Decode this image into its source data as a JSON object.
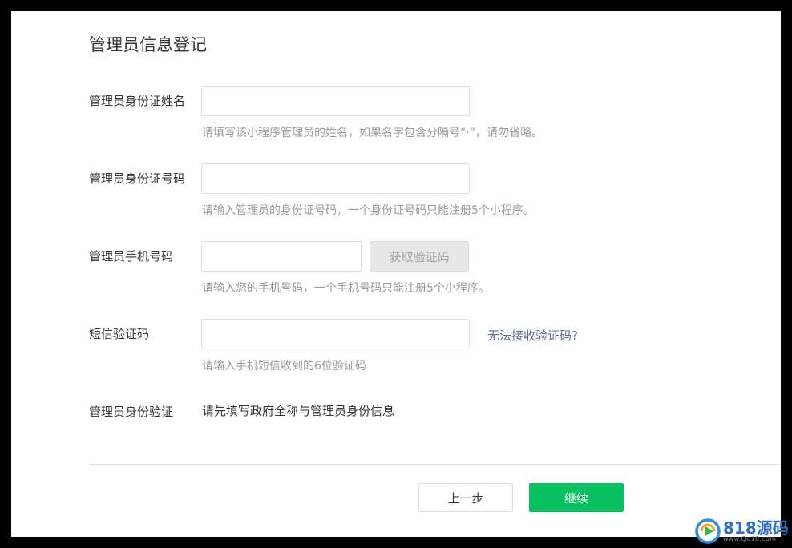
{
  "page": {
    "title": "管理员信息登记"
  },
  "form": {
    "name": {
      "label": "管理员身份证姓名",
      "value": "",
      "hint": "请填写该小程序管理员的姓名，如果名字包含分隔号“·”，请勿省略。"
    },
    "id_number": {
      "label": "管理员身份证号码",
      "value": "",
      "hint": "请输入管理员的身份证号码，一个身份证号码只能注册5个小程序。"
    },
    "phone": {
      "label": "管理员手机号码",
      "value": "",
      "hint": "请输入您的手机号码，一个手机号码只能注册5个小程序。",
      "get_code_label": "获取验证码"
    },
    "sms_code": {
      "label": "短信验证码",
      "value": "",
      "hint": "请输入手机短信收到的6位验证码",
      "cannot_receive_link": "无法接收验证码?"
    },
    "identity_verify": {
      "label": "管理员身份验证",
      "value": "请先填写政府全称与管理员身份信息"
    }
  },
  "footer": {
    "prev_label": "上一步",
    "next_label": "继续"
  },
  "watermark": {
    "brand": "818源码",
    "url": "www.Qd18.com",
    "icon": "play-circle-icon"
  },
  "colors": {
    "primary_button": "#07c160",
    "link": "#576b95",
    "disabled_button": "#e7e7e7"
  }
}
